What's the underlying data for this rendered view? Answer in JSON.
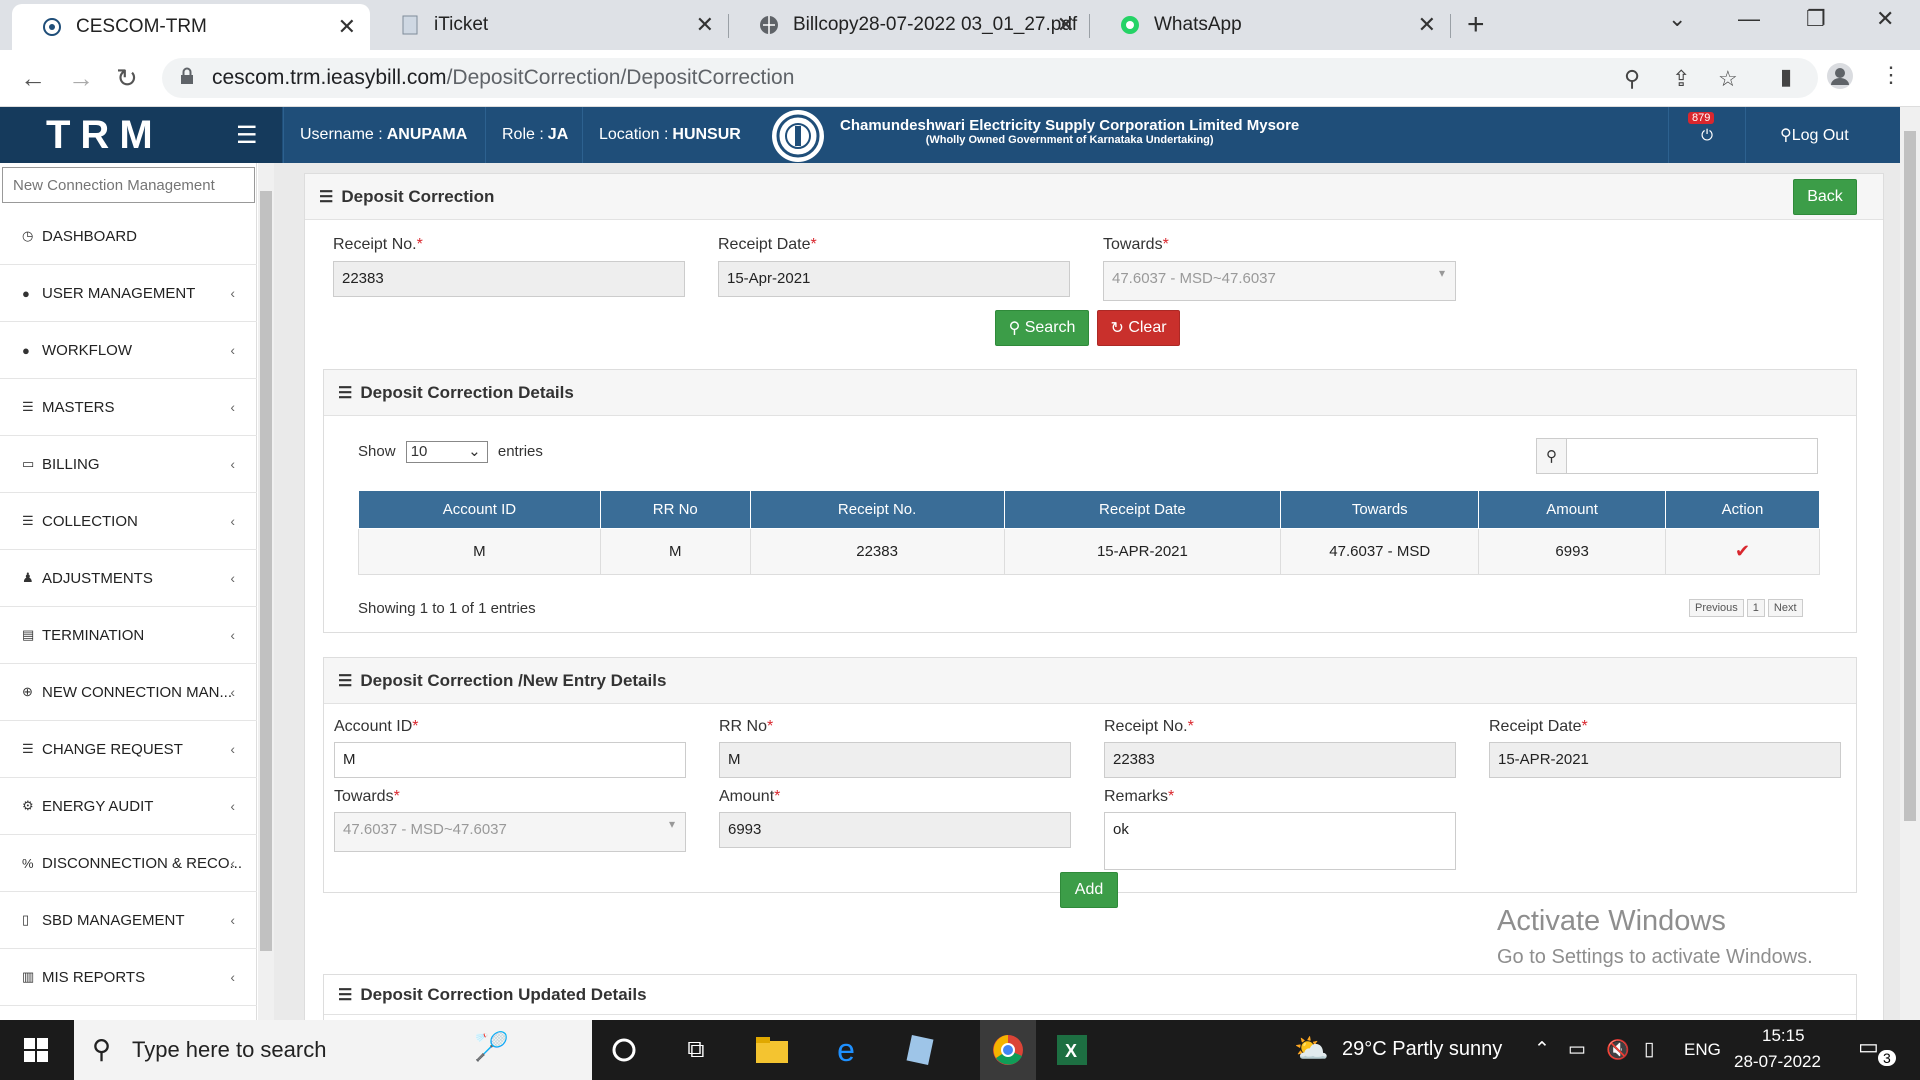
{
  "browser": {
    "tabs": [
      {
        "title": "CESCOM-TRM",
        "active": true
      },
      {
        "title": "iTicket",
        "active": false
      },
      {
        "title": "Billcopy28-07-2022 03_01_27.pdf",
        "active": false
      },
      {
        "title": "WhatsApp",
        "active": false
      }
    ],
    "url_host": "cescom.trm.ieasybill.com",
    "url_path": "/DepositCorrection/DepositCorrection"
  },
  "header": {
    "brand": "TRM",
    "username_label": "Username :",
    "username": "ANUPAMA",
    "role_label": "Role :",
    "role": "JA",
    "location_label": "Location :",
    "location": "HUNSUR",
    "corp_name": "Chamundeshwari Electricity Supply Corporation Limited Mysore",
    "corp_sub": "(Wholly Owned Government of Karnataka Undertaking)",
    "notification_count": "879",
    "logout": "Log Out"
  },
  "sidebar": {
    "search_placeholder": "New Connection Management",
    "items": [
      {
        "label": "DASHBOARD",
        "icon": "dashboard-icon"
      },
      {
        "label": "USER MANAGEMENT",
        "icon": "user-icon"
      },
      {
        "label": "WORKFLOW",
        "icon": "user-icon"
      },
      {
        "label": "MASTERS",
        "icon": "list-icon"
      },
      {
        "label": "BILLING",
        "icon": "monitor-icon"
      },
      {
        "label": "COLLECTION",
        "icon": "list-icon"
      },
      {
        "label": "ADJUSTMENTS",
        "icon": "users-icon"
      },
      {
        "label": "TERMINATION",
        "icon": "trash-icon"
      },
      {
        "label": "NEW CONNECTION MAN...",
        "icon": "plus-circle-icon"
      },
      {
        "label": "CHANGE REQUEST",
        "icon": "list-icon"
      },
      {
        "label": "ENERGY AUDIT",
        "icon": "cogs-icon"
      },
      {
        "label": "DISCONNECTION & RECO...",
        "icon": "link-icon"
      },
      {
        "label": "SBD MANAGEMENT",
        "icon": "mobile-icon"
      },
      {
        "label": "MIS REPORTS",
        "icon": "chart-icon"
      }
    ]
  },
  "search_panel": {
    "title": "Deposit Correction",
    "back": "Back",
    "receipt_no_label": "Receipt No.",
    "receipt_no": "22383",
    "receipt_date_label": "Receipt Date",
    "receipt_date": "15-Apr-2021",
    "towards_label": "Towards",
    "towards": "47.6037 - MSD~47.6037",
    "search_btn": "Search",
    "clear_btn": "Clear"
  },
  "details": {
    "title": "Deposit Correction Details",
    "show": "Show",
    "entries_value": "10",
    "entries": "entries",
    "columns": [
      "Account ID",
      "RR No",
      "Receipt No.",
      "Receipt Date",
      "Towards",
      "Amount",
      "Action"
    ],
    "rows": [
      {
        "account_id": "M",
        "rr_no": "M",
        "receipt_no": "22383",
        "receipt_date": "15-APR-2021",
        "towards": "47.6037 - MSD",
        "amount": "6993"
      }
    ],
    "info": "Showing 1 to 1 of 1 entries",
    "prev": "Previous",
    "page": "1",
    "next": "Next"
  },
  "entry": {
    "title": "Deposit Correction /New Entry Details",
    "account_id_label": "Account ID",
    "account_id": "M",
    "rr_no_label": "RR No",
    "rr_no": "M",
    "receipt_no_label": "Receipt No.",
    "receipt_no": "22383",
    "receipt_date_label": "Receipt Date",
    "receipt_date": "15-APR-2021",
    "towards_label": "Towards",
    "towards": "47.6037 - MSD~47.6037",
    "amount_label": "Amount",
    "amount": "6993",
    "remarks_label": "Remarks",
    "remarks": "ok",
    "add_btn": "Add"
  },
  "updated": {
    "title": "Deposit Correction Updated Details"
  },
  "watermark": {
    "line1": "Activate Windows",
    "line2": "Go to Settings to activate Windows."
  },
  "taskbar": {
    "search": "Type here to search",
    "weather": "29°C  Partly sunny",
    "lang": "ENG",
    "time": "15:15",
    "date": "28-07-2022",
    "notif": "3"
  }
}
